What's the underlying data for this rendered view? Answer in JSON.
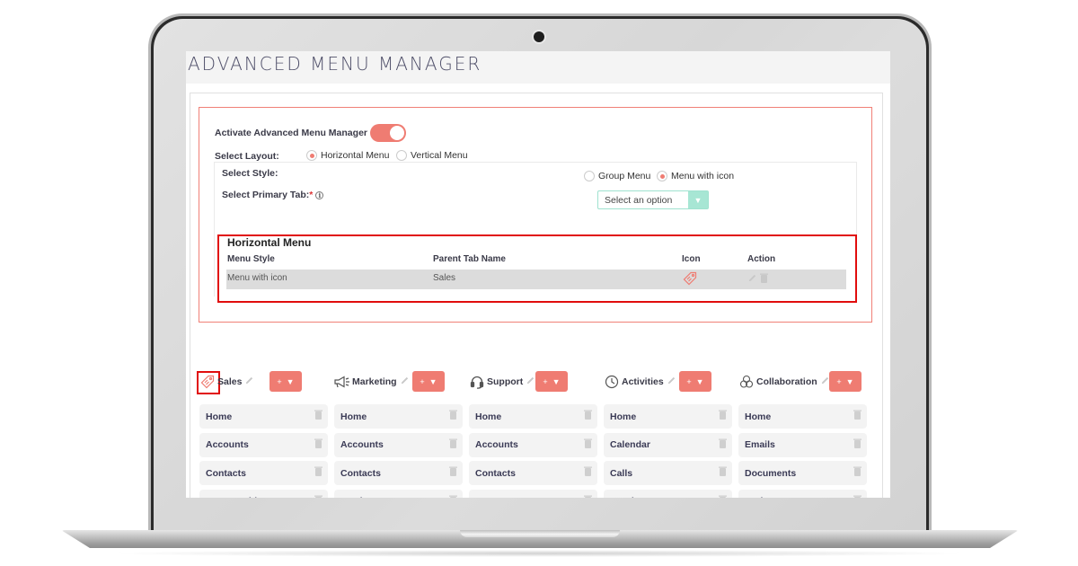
{
  "page": {
    "title": "ADVANCED MENU MANAGER"
  },
  "settings": {
    "activate_label": "Activate Advanced Menu Manager",
    "activate_on": true,
    "layout_label": "Select Layout:",
    "layout_options": [
      {
        "label": "Horizontal Menu",
        "selected": true
      },
      {
        "label": "Vertical Menu",
        "selected": false
      }
    ],
    "style_label": "Select Style:",
    "style_options": [
      {
        "label": "Group Menu",
        "selected": false
      },
      {
        "label": "Menu with icon",
        "selected": true
      }
    ],
    "primary_tab_label": "Select Primary Tab:",
    "primary_tab_required": "*",
    "primary_tab_placeholder": "Select an option"
  },
  "horizontal_menu": {
    "title": "Horizontal Menu",
    "columns": [
      "Menu Style",
      "Parent Tab Name",
      "Icon",
      "Action"
    ],
    "rows": [
      {
        "menu_style": "Menu with icon",
        "parent_tab": "Sales",
        "icon": "tag-icon"
      }
    ]
  },
  "menu_groups": [
    {
      "name": "Sales",
      "icon": "tag-icon",
      "add_label": "+",
      "items": [
        "Home",
        "Accounts",
        "Contacts",
        "Opportunities"
      ]
    },
    {
      "name": "Marketing",
      "icon": "megaphone-icon",
      "add_label": "+",
      "items": [
        "Home",
        "Accounts",
        "Contacts",
        "Leads"
      ]
    },
    {
      "name": "Support",
      "icon": "headset-icon",
      "add_label": "+",
      "items": [
        "Home",
        "Accounts",
        "Contacts",
        "Cases"
      ]
    },
    {
      "name": "Activities",
      "icon": "clock-icon",
      "add_label": "+",
      "items": [
        "Home",
        "Calendar",
        "Calls",
        "Meetings"
      ]
    },
    {
      "name": "Collaboration",
      "icon": "collaboration-icon",
      "add_label": "+",
      "items": [
        "Home",
        "Emails",
        "Documents",
        "Projects"
      ]
    }
  ],
  "colors": {
    "accent": "#ef7c72",
    "highlight": "#e10d0d",
    "select_accent": "#a7e6d4"
  }
}
